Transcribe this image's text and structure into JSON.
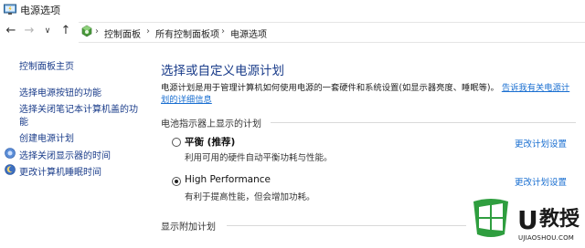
{
  "window": {
    "title": "电源选项"
  },
  "nav": {
    "back_icon": "←",
    "forward_icon": "→",
    "dropdown_icon": "∨",
    "up_icon": "↑"
  },
  "breadcrumb": [
    {
      "label": "控制面板"
    },
    {
      "label": "所有控制面板项"
    },
    {
      "label": "电源选项"
    }
  ],
  "breadcrumb_sep": "›",
  "sidebar": {
    "items": [
      {
        "label": "控制面板主页"
      },
      {
        "label": "选择电源按钮的功能"
      },
      {
        "label": "选择关闭笔记本计算机盖的功"
      },
      {
        "label": "能"
      },
      {
        "label": "创建电源计划"
      },
      {
        "label": "选择关闭显示器的时间",
        "icon": "display-icon"
      },
      {
        "label": "更改计算机睡眠时间",
        "icon": "moon-icon"
      }
    ]
  },
  "main": {
    "heading": "选择或自定义电源计划",
    "description": "电源计划是用于管理计算机如何使用电源的一套硬件和系统设置(如显示器亮度、睡眠等)。",
    "more_link_1": "告诉我有关电源计",
    "more_link_2": "划的详细信息",
    "battery_section": "电池指示器上显示的计划",
    "plans": [
      {
        "name": "平衡 (推荐)",
        "desc": "利用可用的硬件自动平衡功耗与性能。",
        "selected": false,
        "change": "更改计划设置"
      },
      {
        "name": "High Performance",
        "desc": "有利于提高性能，但会增加功耗。",
        "selected": true,
        "change": "更改计划设置"
      }
    ],
    "additional_section": "显示附加计划"
  },
  "watermark": {
    "mark": "U",
    "text": "教授",
    "url": "UJIAOSHOU.COM"
  },
  "colors": {
    "link": "#1a3c8a",
    "accent_link": "#1a6fd1"
  }
}
